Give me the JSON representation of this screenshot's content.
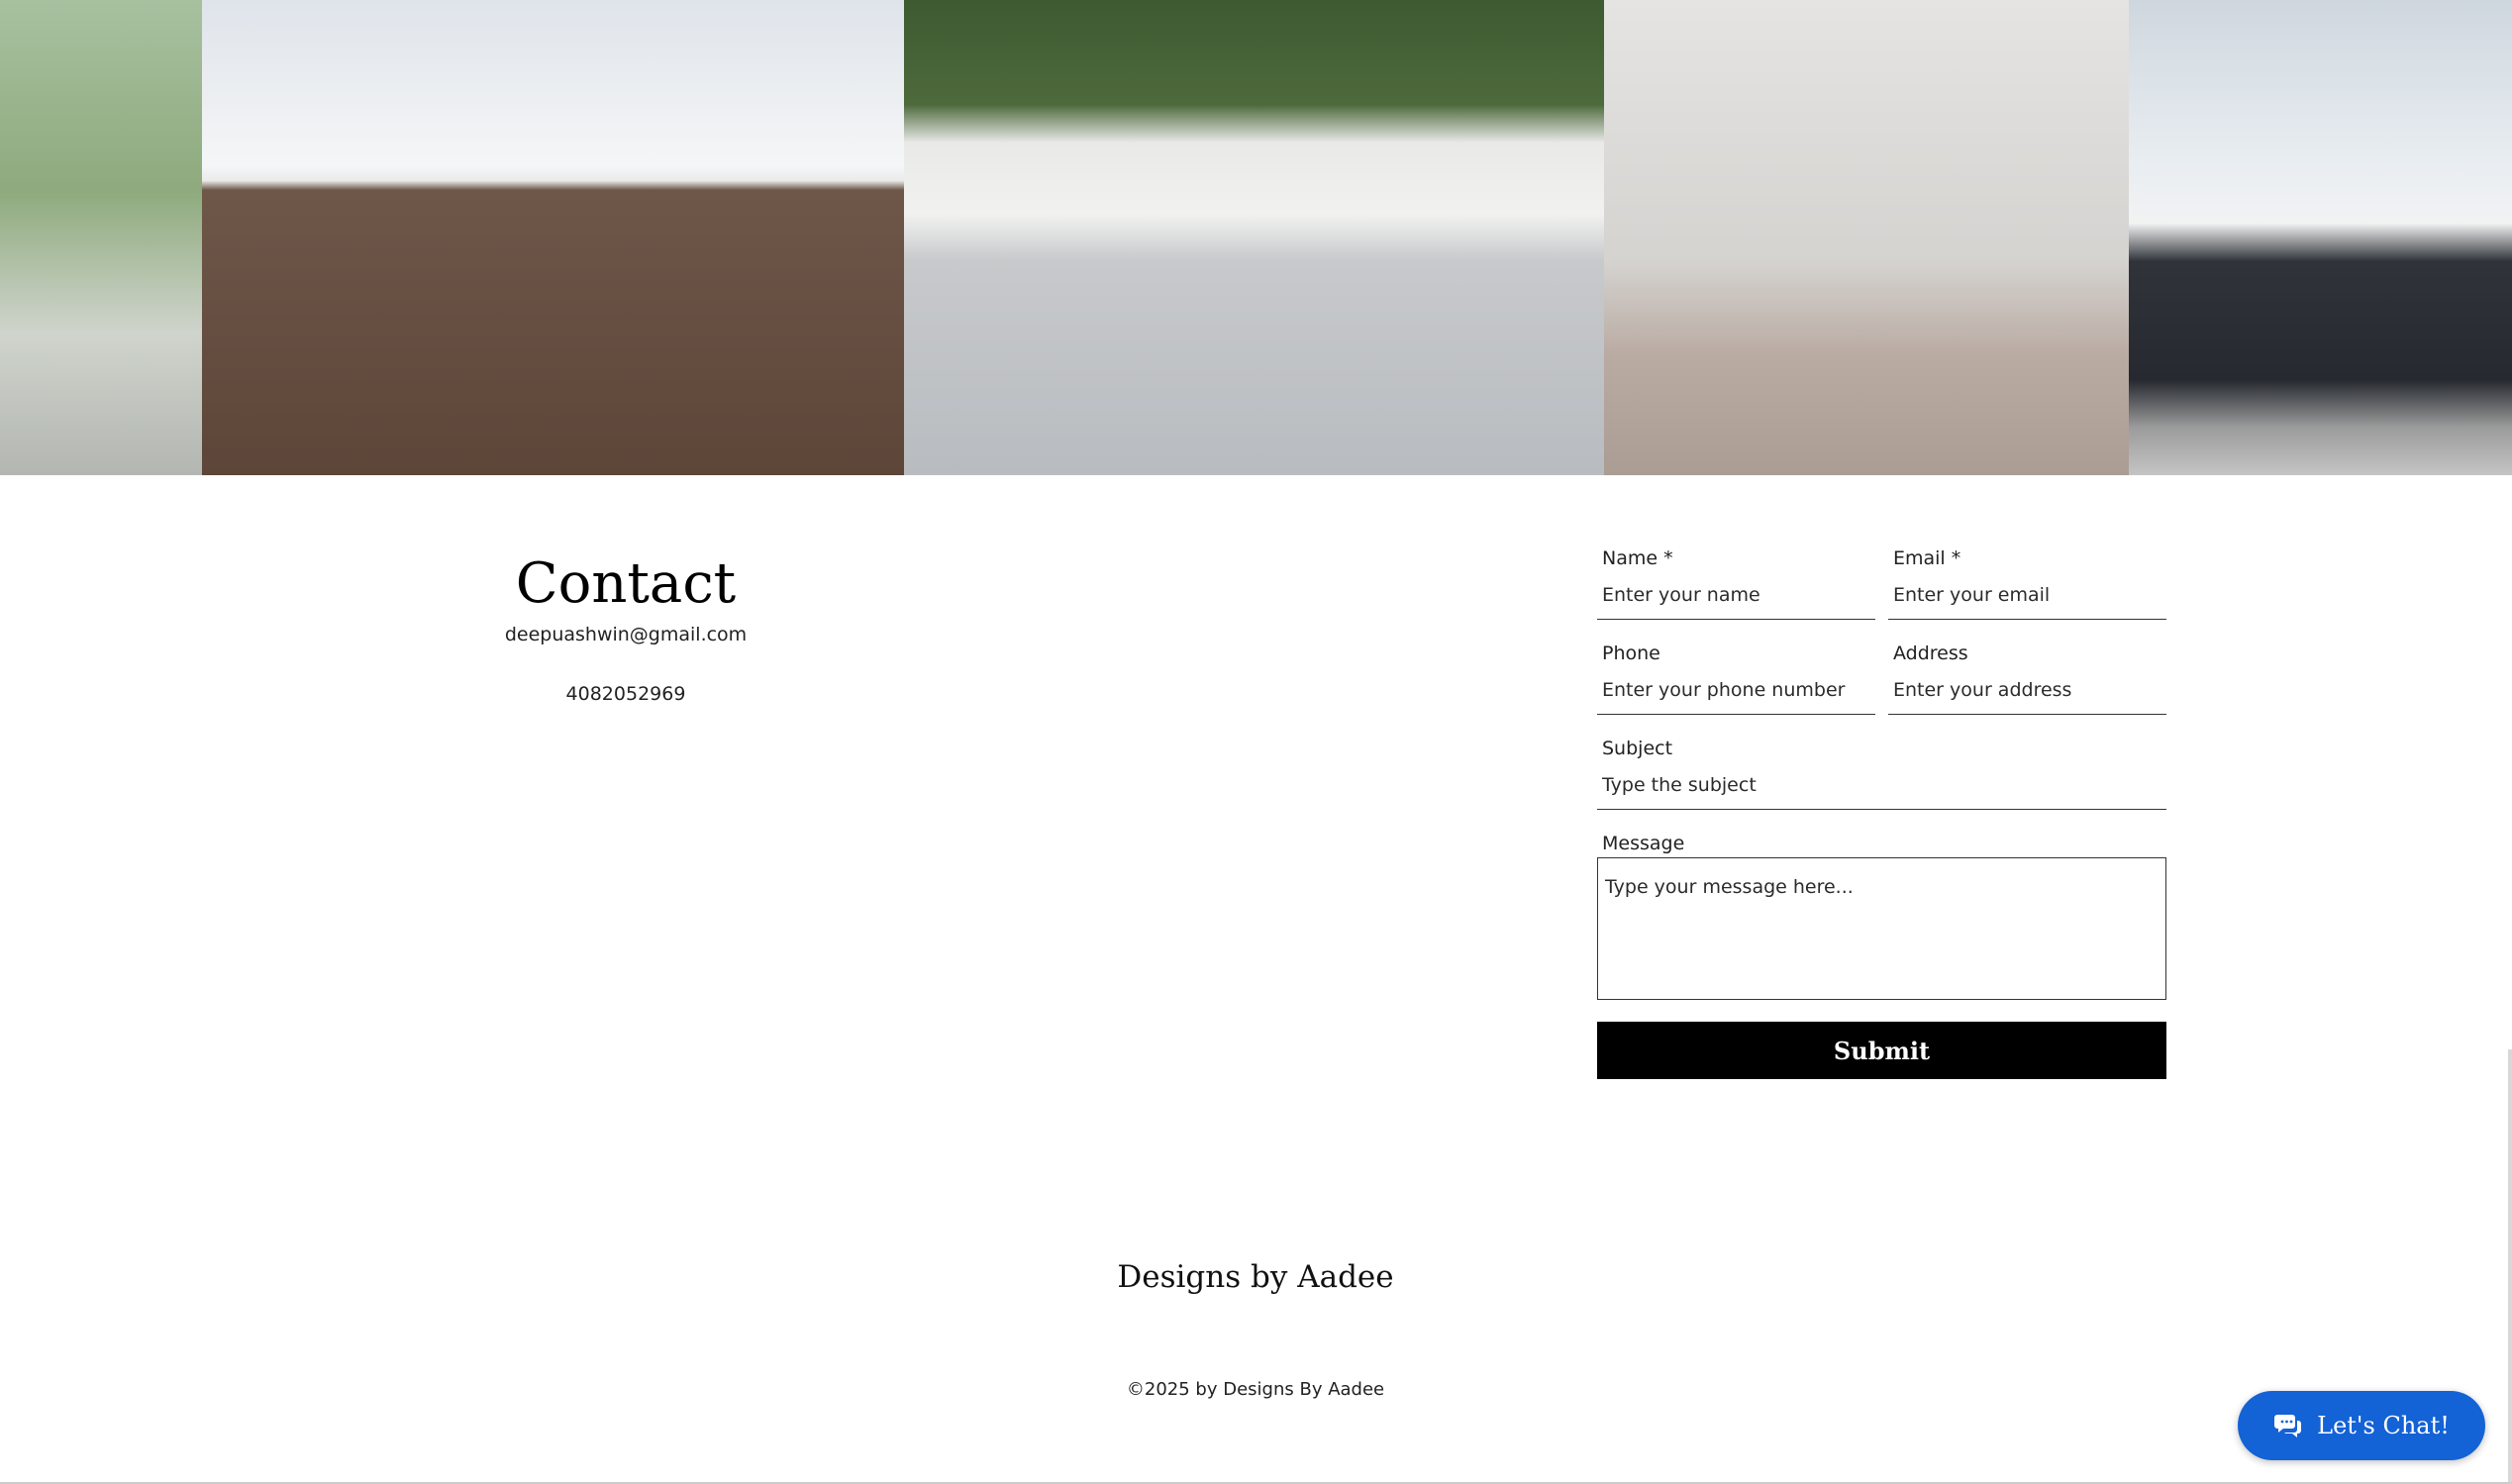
{
  "contact": {
    "title": "Contact",
    "email": "deepuashwin@gmail.com",
    "phone": "4082052969"
  },
  "form": {
    "name_label": "Name *",
    "name_placeholder": "Enter your name",
    "email_label": "Email *",
    "email_placeholder": "Enter your email",
    "phone_label": "Phone",
    "phone_placeholder": "Enter your phone number",
    "address_label": "Address",
    "address_placeholder": "Enter your address",
    "subject_label": "Subject",
    "subject_placeholder": "Type the subject",
    "message_label": "Message",
    "message_placeholder": "Type your message here...",
    "submit_label": "Submit"
  },
  "footer": {
    "brand": "Designs by Aadee",
    "copyright": "©2025 by Designs By Aadee"
  },
  "chat": {
    "label": "Let's Chat!",
    "icon": "chat-bubbles-icon",
    "color": "#1362d6"
  },
  "colors": {
    "submit_background": "#000000",
    "page_background": "#ffffff"
  }
}
